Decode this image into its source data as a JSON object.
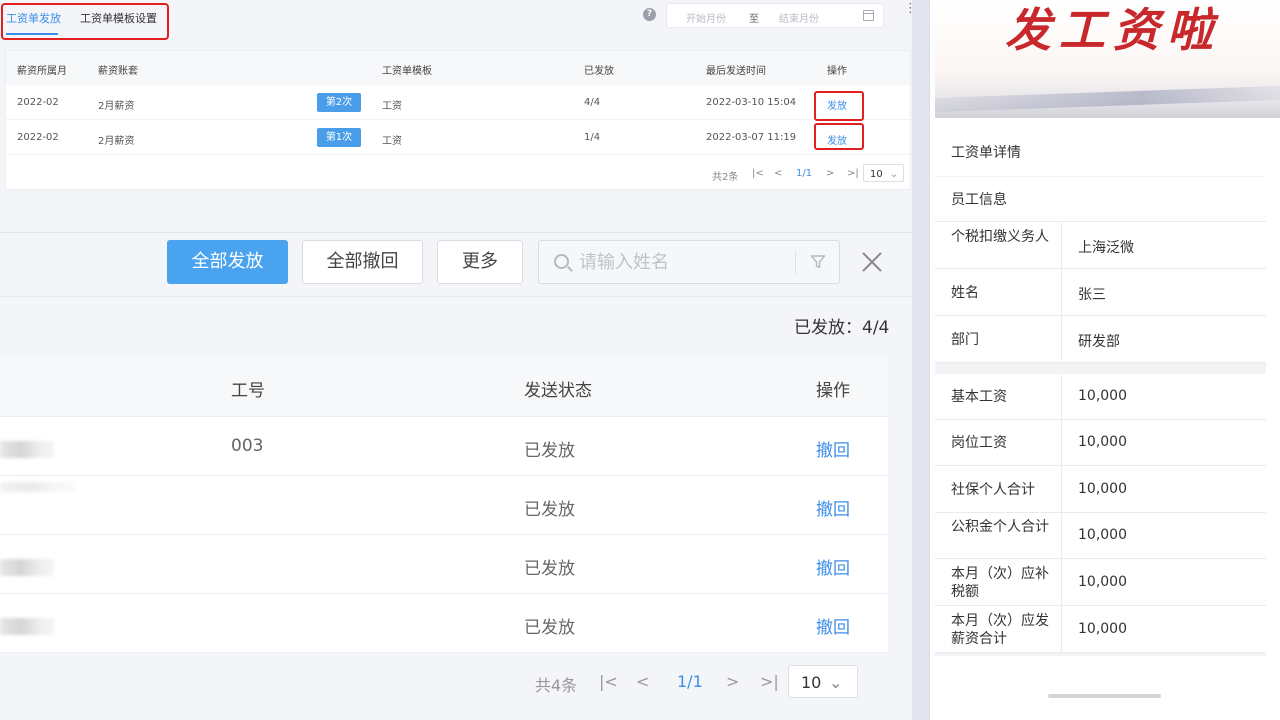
{
  "tabs": {
    "send_label": "工资单发放",
    "template_label": "工资单模板设置"
  },
  "date_range": {
    "start_placeholder": "开始月份",
    "separator": "至",
    "end_placeholder": "结束月份"
  },
  "payroll_table": {
    "headers": [
      "薪资所属月",
      "薪资账套",
      "工资单模板",
      "已发放",
      "最后发送时间",
      "操作"
    ],
    "rows": [
      {
        "month": "2022-02",
        "account": "2月薪资",
        "batch": "第2次",
        "template": "工资",
        "sent": "4/4",
        "last_sent": "2022-03-10 15:04",
        "action": "发放"
      },
      {
        "month": "2022-02",
        "account": "2月薪资",
        "batch": "第1次",
        "template": "工资",
        "sent": "1/4",
        "last_sent": "2022-03-07 11:19",
        "action": "发放"
      }
    ],
    "pager": {
      "total": "共2条",
      "page": "1/1",
      "size": "10"
    }
  },
  "dialog": {
    "send_all_label": "全部发放",
    "recall_all_label": "全部撤回",
    "more_label": "更多",
    "search_placeholder": "请输入姓名",
    "sent_count": "已发放：4/4",
    "headers": {
      "emp_no": "工号",
      "status": "发送状态",
      "action": "操作"
    },
    "rows": [
      {
        "emp_no": "003",
        "status": "已发放",
        "action": "撤回"
      },
      {
        "emp_no": "",
        "status": "已发放",
        "action": "撤回"
      },
      {
        "emp_no": "",
        "status": "已发放",
        "action": "撤回"
      },
      {
        "emp_no": "",
        "status": "已发放",
        "action": "撤回"
      }
    ],
    "pager": {
      "total": "共4条",
      "page": "1/1",
      "size": "10"
    }
  },
  "phone": {
    "banner_text": "发工资啦",
    "detail_title": "工资单详情",
    "section_title": "员工信息",
    "employee_info": [
      {
        "label": "个税扣缴义务人",
        "value": "上海泛微"
      },
      {
        "label": "姓名",
        "value": "张三"
      },
      {
        "label": "部门",
        "value": "研发部"
      }
    ],
    "salary_items": [
      {
        "label": "基本工资",
        "value": "10,000"
      },
      {
        "label": "岗位工资",
        "value": "10,000"
      },
      {
        "label": "社保个人合计",
        "value": "10,000"
      },
      {
        "label": "公积金个人合计",
        "value": "10,000"
      },
      {
        "label": "本月（次）应补税额",
        "value": "10,000"
      },
      {
        "label": "本月（次）应发薪资合计",
        "value": "10,000"
      }
    ]
  },
  "colors": {
    "accent": "#3d8ee8",
    "primary_button": "#4aa3ee",
    "highlight_border": "#e02020",
    "banner_red": "#c8282b"
  }
}
